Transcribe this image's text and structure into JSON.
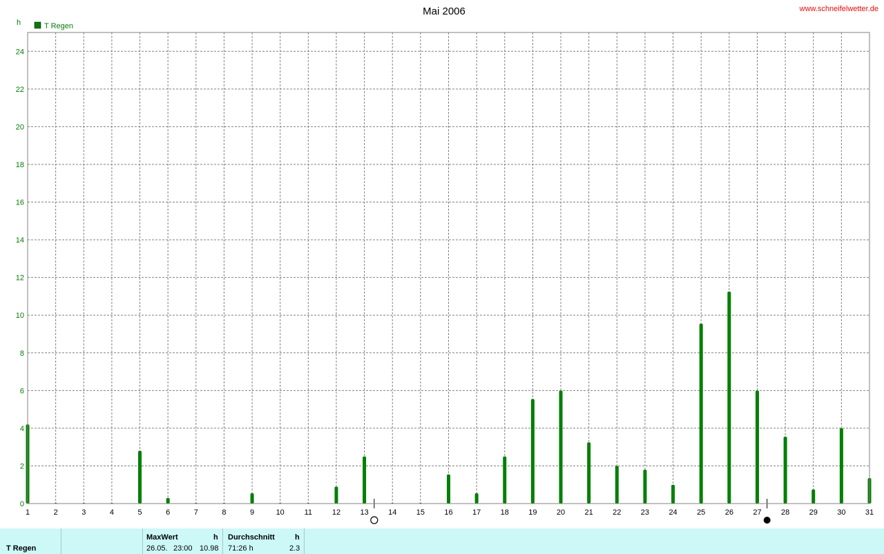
{
  "header": {
    "title": "Mai 2006",
    "site": "www.schneifelwetter.de",
    "unit": "h"
  },
  "colors": {
    "series": "#008000",
    "axis": "#008000",
    "grid": "#808080",
    "footer_bg": "#ccf8f8"
  },
  "chart_data": {
    "type": "bar",
    "title": "Mai 2006",
    "ylabel": "h",
    "ylim": [
      0,
      25
    ],
    "yticks": [
      0,
      2,
      4,
      6,
      8,
      10,
      12,
      14,
      16,
      18,
      20,
      22,
      24
    ],
    "grid": true,
    "legend_position": "top-left",
    "categories": [
      "1",
      "2",
      "3",
      "4",
      "5",
      "6",
      "7",
      "8",
      "9",
      "10",
      "11",
      "12",
      "13",
      "14",
      "15",
      "16",
      "17",
      "18",
      "19",
      "20",
      "21",
      "22",
      "23",
      "24",
      "25",
      "26",
      "27",
      "28",
      "29",
      "30",
      "31"
    ],
    "series": [
      {
        "name": "T Regen",
        "color": "#008000",
        "values": [
          4.2,
          0,
          0,
          0,
          2.8,
          0.3,
          0,
          0,
          0.55,
          0,
          0,
          0.9,
          2.5,
          0,
          0,
          1.55,
          0.55,
          2.5,
          5.55,
          6.0,
          3.25,
          2.0,
          1.8,
          1.0,
          9.55,
          11.25,
          6.0,
          3.55,
          0.75,
          4.0,
          1.35
        ]
      }
    ],
    "moon_phases": [
      {
        "symbol": "full-moon",
        "day": "13"
      },
      {
        "symbol": "new-moon",
        "day": "27"
      }
    ]
  },
  "footer": {
    "series_label": "T Regen",
    "max_label": "MaxWert",
    "max_unit": "h",
    "max_date": "26.05.",
    "max_time": "23:00",
    "max_value": "10.98",
    "avg_label": "Durchschnitt",
    "avg_unit": "h",
    "avg_duration": "71:26 h",
    "avg_value": "2.3"
  }
}
